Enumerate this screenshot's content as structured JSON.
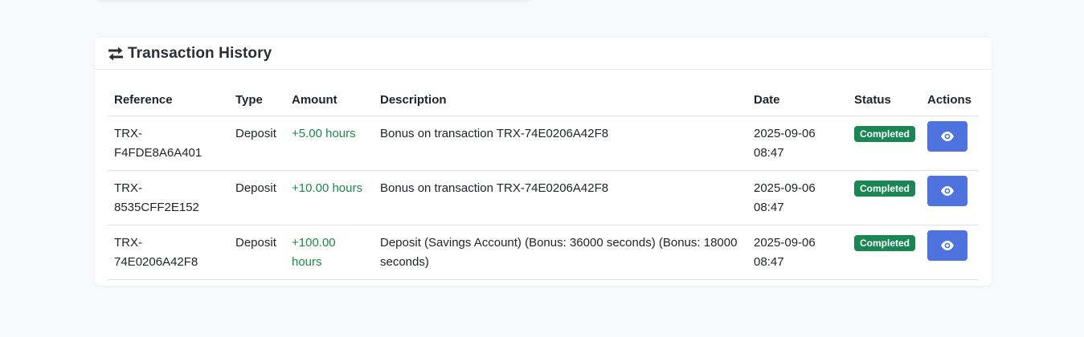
{
  "card": {
    "title": "Transaction History",
    "icon": "exchange-arrows-icon"
  },
  "table": {
    "headers": {
      "reference": "Reference",
      "type": "Type",
      "amount": "Amount",
      "description": "Description",
      "date": "Date",
      "status": "Status",
      "actions": "Actions"
    },
    "rows": [
      {
        "reference_line1": "TRX-",
        "reference_line2": "F4FDE8A6A401",
        "type": "Deposit",
        "amount": "+5.00 hours",
        "description": "Bonus on transaction TRX-74E0206A42F8",
        "date_line1": "2025-09-06",
        "date_line2": "08:47",
        "status": "Completed"
      },
      {
        "reference_line1": "TRX-",
        "reference_line2": "8535CFF2E152",
        "type": "Deposit",
        "amount": "+10.00 hours",
        "description": "Bonus on transaction TRX-74E0206A42F8",
        "date_line1": "2025-09-06",
        "date_line2": "08:47",
        "status": "Completed"
      },
      {
        "reference_line1": "TRX-",
        "reference_line2": "74E0206A42F8",
        "type": "Deposit",
        "amount": "+100.00 hours",
        "description": "Deposit (Savings Account) (Bonus: 36000 seconds) (Bonus: 18000 seconds)",
        "date_line1": "2025-09-06",
        "date_line2": "08:47",
        "status": "Completed"
      }
    ]
  },
  "colors": {
    "positive_amount": "#1a8a4a",
    "status_completed": "#198754",
    "action_button": "#4e73df"
  }
}
